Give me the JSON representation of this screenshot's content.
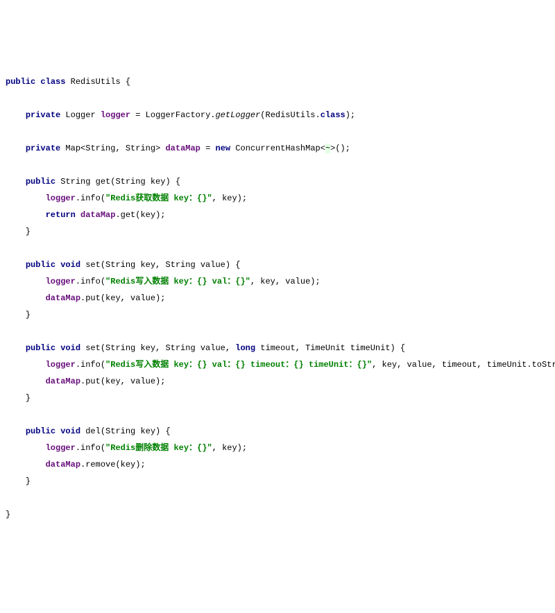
{
  "tokens": [
    [
      [
        "kw",
        "public"
      ],
      [
        "plain",
        " "
      ],
      [
        "kw",
        "class"
      ],
      [
        "plain",
        " RedisUtils {"
      ]
    ],
    [],
    [
      [
        "plain",
        "    "
      ],
      [
        "kw",
        "private"
      ],
      [
        "plain",
        " Logger "
      ],
      [
        "field",
        "logger"
      ],
      [
        "plain",
        " = LoggerFactory."
      ],
      [
        "italic",
        "getLogger"
      ],
      [
        "plain",
        "(RedisUtils."
      ],
      [
        "kw",
        "class"
      ],
      [
        "plain",
        ");"
      ]
    ],
    [],
    [
      [
        "plain",
        "    "
      ],
      [
        "kw",
        "private"
      ],
      [
        "plain",
        " Map<String, String> "
      ],
      [
        "field",
        "dataMap"
      ],
      [
        "plain",
        " = "
      ],
      [
        "kw",
        "new"
      ],
      [
        "plain",
        " ConcurrentHashMap<"
      ],
      [
        "bg",
        "~"
      ],
      [
        "plain",
        ">();"
      ]
    ],
    [],
    [
      [
        "plain",
        "    "
      ],
      [
        "kw",
        "public"
      ],
      [
        "plain",
        " String get(String key) {"
      ]
    ],
    [
      [
        "plain",
        "        "
      ],
      [
        "field",
        "logger"
      ],
      [
        "plain",
        ".info("
      ],
      [
        "str",
        "\"Redis获取数据 key：{}\""
      ],
      [
        "plain",
        ", key);"
      ]
    ],
    [
      [
        "plain",
        "        "
      ],
      [
        "kw",
        "return"
      ],
      [
        "plain",
        " "
      ],
      [
        "field",
        "dataMap"
      ],
      [
        "plain",
        ".get(key);"
      ]
    ],
    [
      [
        "plain",
        "    }"
      ]
    ],
    [],
    [
      [
        "plain",
        "    "
      ],
      [
        "kw",
        "public void"
      ],
      [
        "plain",
        " set(String key, String value) {"
      ]
    ],
    [
      [
        "plain",
        "        "
      ],
      [
        "field",
        "logger"
      ],
      [
        "plain",
        ".info("
      ],
      [
        "str",
        "\"Redis写入数据 key：{} val：{}\""
      ],
      [
        "plain",
        ", key, value);"
      ]
    ],
    [
      [
        "plain",
        "        "
      ],
      [
        "field",
        "dataMap"
      ],
      [
        "plain",
        ".put(key, value);"
      ]
    ],
    [
      [
        "plain",
        "    }"
      ]
    ],
    [],
    [
      [
        "plain",
        "    "
      ],
      [
        "kw",
        "public void"
      ],
      [
        "plain",
        " set(String key, String value, "
      ],
      [
        "kw",
        "long"
      ],
      [
        "plain",
        " timeout, TimeUnit timeUnit) {"
      ]
    ],
    [
      [
        "plain",
        "        "
      ],
      [
        "field",
        "logger"
      ],
      [
        "plain",
        ".info("
      ],
      [
        "str",
        "\"Redis写入数据 key：{} val：{} timeout：{} timeUnit：{}\""
      ],
      [
        "plain",
        ", key, value, timeout, timeUnit.toString());"
      ]
    ],
    [
      [
        "plain",
        "        "
      ],
      [
        "field",
        "dataMap"
      ],
      [
        "plain",
        ".put(key, value);"
      ]
    ],
    [
      [
        "plain",
        "    }"
      ]
    ],
    [],
    [
      [
        "plain",
        "    "
      ],
      [
        "kw",
        "public void"
      ],
      [
        "plain",
        " del(String key) {"
      ]
    ],
    [
      [
        "plain",
        "        "
      ],
      [
        "field",
        "logger"
      ],
      [
        "plain",
        ".info("
      ],
      [
        "str",
        "\"Redis删除数据 key：{}\""
      ],
      [
        "plain",
        ", key);"
      ]
    ],
    [
      [
        "plain",
        "        "
      ],
      [
        "field",
        "dataMap"
      ],
      [
        "plain",
        ".remove(key);"
      ]
    ],
    [
      [
        "plain",
        "    }"
      ]
    ],
    [],
    [
      [
        "plain",
        "}"
      ]
    ]
  ]
}
